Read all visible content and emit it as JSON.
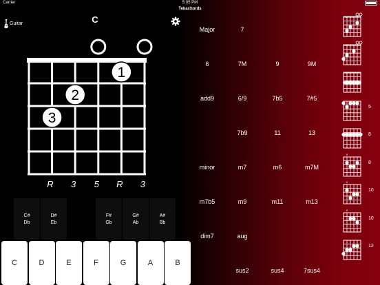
{
  "status": {
    "carrier": "Carrier",
    "time": "5:05 PM"
  },
  "app_title": "Tekachords",
  "instrument": {
    "label": "Guitar"
  },
  "chord": {
    "name": "C"
  },
  "diagram": {
    "open_strings": [
      4,
      6
    ],
    "fingers": [
      {
        "string": 5,
        "fret": 1,
        "label": "1"
      },
      {
        "string": 3,
        "fret": 2,
        "label": "2"
      },
      {
        "string": 2,
        "fret": 3,
        "label": "3"
      }
    ],
    "intervals": [
      "R",
      "3",
      "5",
      "R",
      "3"
    ]
  },
  "keyboard": {
    "black_keys": [
      {
        "top": "C#",
        "bottom": "Db"
      },
      {
        "top": "D#",
        "bottom": "Eb"
      },
      {
        "top": "F#",
        "bottom": "Gb"
      },
      {
        "top": "G#",
        "bottom": "Ab"
      },
      {
        "top": "A#",
        "bottom": "Bb"
      }
    ],
    "white_keys": [
      "C",
      "D",
      "E",
      "F",
      "G",
      "A",
      "B"
    ]
  },
  "chord_types": [
    [
      "Major",
      "7",
      "",
      ""
    ],
    [
      "6",
      "7M",
      "9",
      "9M"
    ],
    [
      "add9",
      "6/9",
      "7b5",
      "7#5"
    ],
    [
      "",
      "7b9",
      "11",
      "13"
    ],
    [
      "minor",
      "m7",
      "m6",
      "m7M"
    ],
    [
      "m7b5",
      "m9",
      "m11",
      "m13"
    ],
    [
      "dim7",
      "aug",
      "",
      ""
    ],
    [
      "",
      "sus2",
      "sus4",
      "7sus4"
    ]
  ],
  "thumbnails": [
    {
      "fret_label": ""
    },
    {
      "fret_label": ""
    },
    {
      "fret_label": ""
    },
    {
      "fret_label": "5"
    },
    {
      "fret_label": "8"
    },
    {
      "fret_label": "8"
    },
    {
      "fret_label": "10"
    },
    {
      "fret_label": "10"
    },
    {
      "fret_label": "12"
    }
  ],
  "colors": {
    "accent": "#86000e",
    "background": "#000000",
    "fretboard": "#ffffff"
  }
}
